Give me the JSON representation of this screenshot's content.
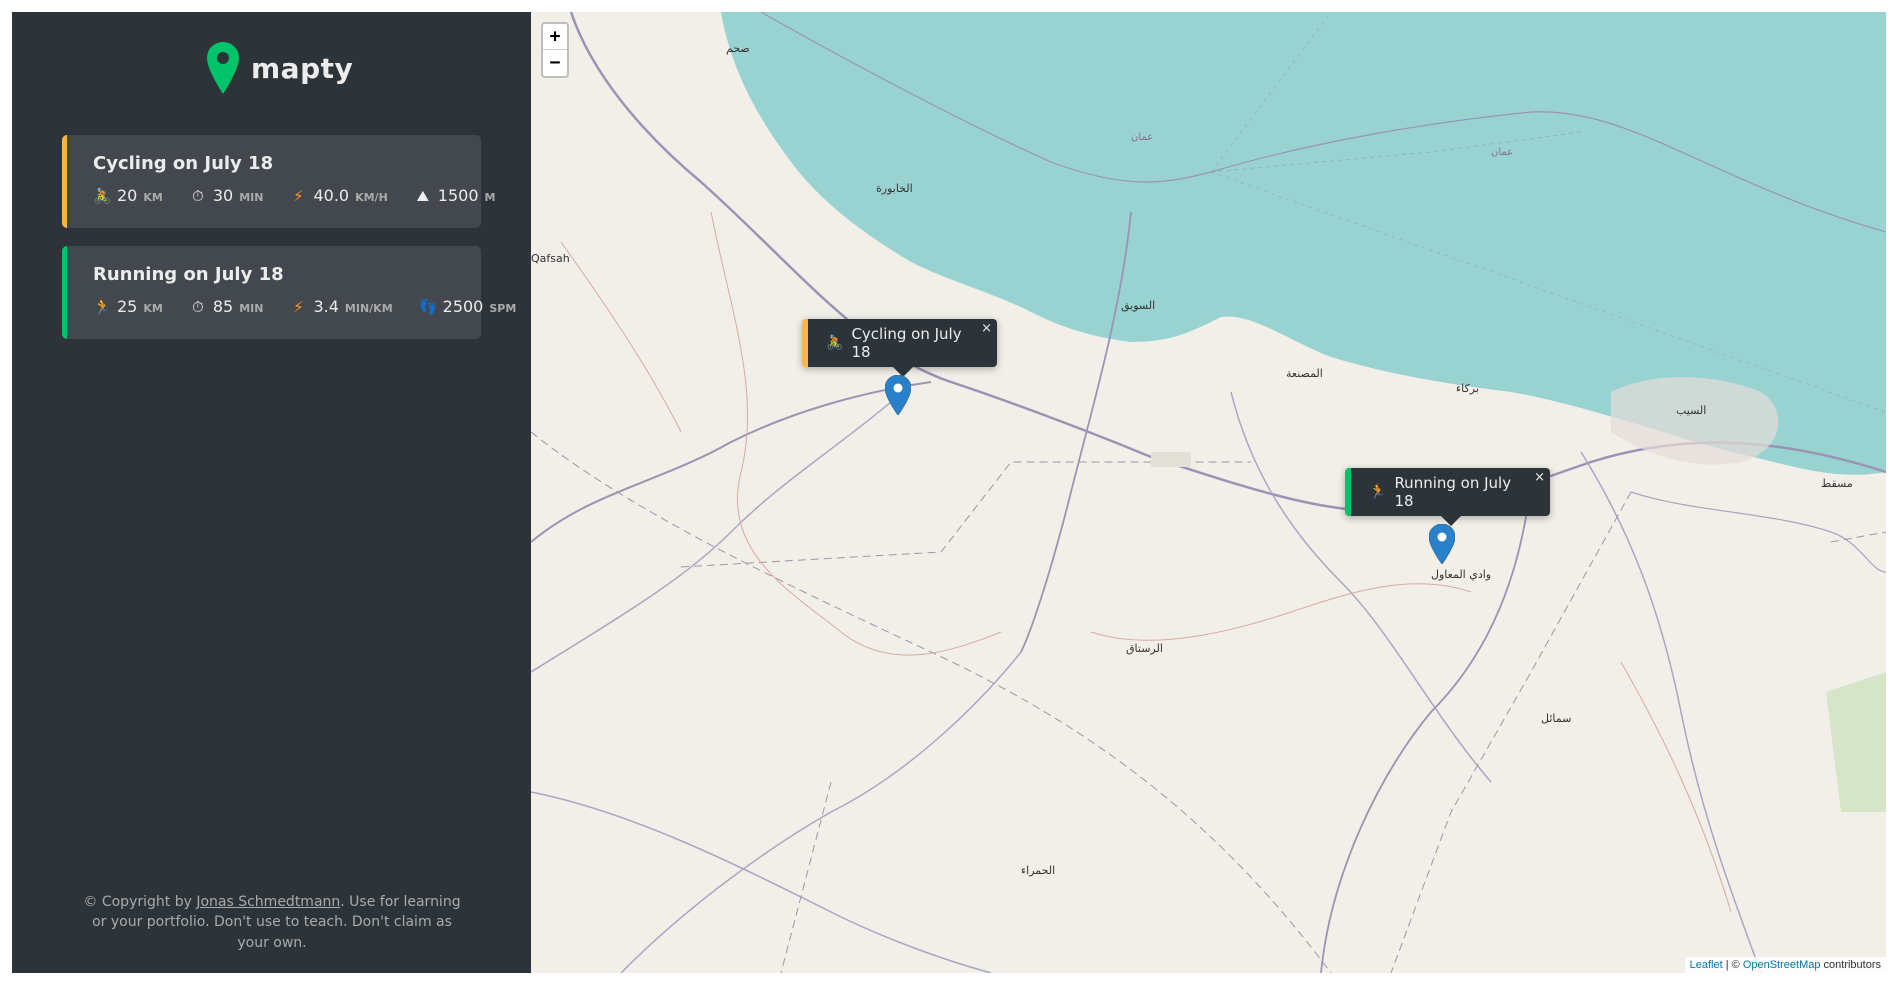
{
  "app": {
    "name": "mapty",
    "colors": {
      "cycling": "#ffb545",
      "running": "#00c46a",
      "sidebar": "#2d3439",
      "card": "#42484d"
    }
  },
  "workouts": [
    {
      "type": "cycling",
      "title": "Cycling on July 18",
      "details": [
        {
          "icon": "bicycle-icon",
          "value": "20",
          "unit": "KM"
        },
        {
          "icon": "stopwatch-icon",
          "value": "30",
          "unit": "MIN"
        },
        {
          "icon": "lightning-icon",
          "value": "40.0",
          "unit": "KM/H"
        },
        {
          "icon": "mountain-icon",
          "value": "1500",
          "unit": "M"
        }
      ]
    },
    {
      "type": "running",
      "title": "Running on July 18",
      "details": [
        {
          "icon": "runner-icon",
          "value": "25",
          "unit": "KM"
        },
        {
          "icon": "stopwatch-icon",
          "value": "85",
          "unit": "MIN"
        },
        {
          "icon": "lightning-icon",
          "value": "3.4",
          "unit": "MIN/KM"
        },
        {
          "icon": "footprint-icon",
          "value": "2500",
          "unit": "SPM"
        }
      ]
    }
  ],
  "copyright": {
    "prefix": "© Copyright by ",
    "author": "Jonas Schmedtmann",
    "suffix": ". Use for learning or your portfolio. Don't use to teach. Don't claim as your own."
  },
  "map": {
    "zoom_in": "+",
    "zoom_out": "−",
    "popups": [
      {
        "type": "cycling",
        "label": "Cycling on July 18",
        "close": "×"
      },
      {
        "type": "running",
        "label": "Running on July 18",
        "close": "×"
      }
    ],
    "attribution": {
      "leaflet": "Leaflet",
      "sep": " | © ",
      "osm": "OpenStreetMap",
      "suffix": " contributors"
    },
    "labels": {
      "qafsah": "Qafsah",
      "suwaiq": "السويق",
      "musanaa": "المصنعة",
      "barka": "بركاء",
      "seeb": "السيب",
      "rustaq": "الرستاق",
      "muscat": "مسقط",
      "khabura": "الخابورة",
      "saham": "صحم",
      "suhail": "سمائل",
      "hamra": "الحمراء",
      "wadi": "وادي المعاول",
      "oman": "عمان"
    }
  }
}
